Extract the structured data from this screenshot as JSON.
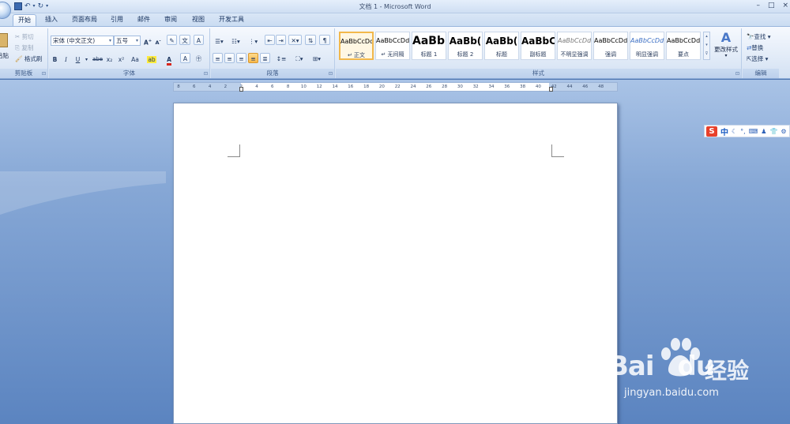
{
  "window": {
    "title": "文档 1 - Microsoft Word",
    "controls": [
      "–",
      "□",
      "×"
    ]
  },
  "tabs": [
    {
      "label": "开始",
      "active": true
    },
    {
      "label": "插入"
    },
    {
      "label": "页面布局"
    },
    {
      "label": "引用"
    },
    {
      "label": "邮件"
    },
    {
      "label": "审阅"
    },
    {
      "label": "视图"
    },
    {
      "label": "开发工具"
    }
  ],
  "clipboard": {
    "paste": "粘贴",
    "cut": "剪切",
    "copy": "复制",
    "format_painter": "格式刷",
    "group_label": "剪贴板"
  },
  "font": {
    "family": "宋体 (中文正文)",
    "size": "五号",
    "group_label": "字体",
    "buttons": [
      "B",
      "I",
      "U",
      "abe",
      "x₂",
      "x²",
      "Aa",
      "A"
    ]
  },
  "paragraph": {
    "group_label": "段落"
  },
  "styles": {
    "group_label": "样式",
    "items": [
      {
        "sample": "AaBbCcDd",
        "name": "↵ 正文",
        "selected": true
      },
      {
        "sample": "AaBbCcDd",
        "name": "↵ 无间隔"
      },
      {
        "sample": "AaBb(",
        "name": "标题 1"
      },
      {
        "sample": "AaBb(",
        "name": "标题 2"
      },
      {
        "sample": "AaBb(",
        "name": "标题"
      },
      {
        "sample": "AaBbC",
        "name": "副标题"
      },
      {
        "sample": "AaBbCcDd",
        "name": "不明显强调"
      },
      {
        "sample": "AaBbCcDd",
        "name": "强调"
      },
      {
        "sample": "AaBbCcDd",
        "name": "明显强调"
      },
      {
        "sample": "AaBbCcDd",
        "name": "要点"
      }
    ],
    "change_styles": "更改样式"
  },
  "editing": {
    "group_label": "编辑",
    "find": "查找",
    "replace": "替换",
    "select": "选择"
  },
  "ruler": {
    "numbers": [
      "8",
      "6",
      "4",
      "2",
      "2",
      "4",
      "6",
      "8",
      "10",
      "12",
      "14",
      "16",
      "18",
      "20",
      "22",
      "24",
      "26",
      "28",
      "30",
      "32",
      "34",
      "36",
      "38",
      "40",
      "42",
      "44",
      "46",
      "48"
    ]
  },
  "ime": {
    "logo": "S",
    "lang": "中"
  },
  "watermark": {
    "brand_latin": "Bai",
    "brand_latin_2": "du",
    "brand_cn": "经验",
    "url": "jingyan.baidu.com"
  }
}
